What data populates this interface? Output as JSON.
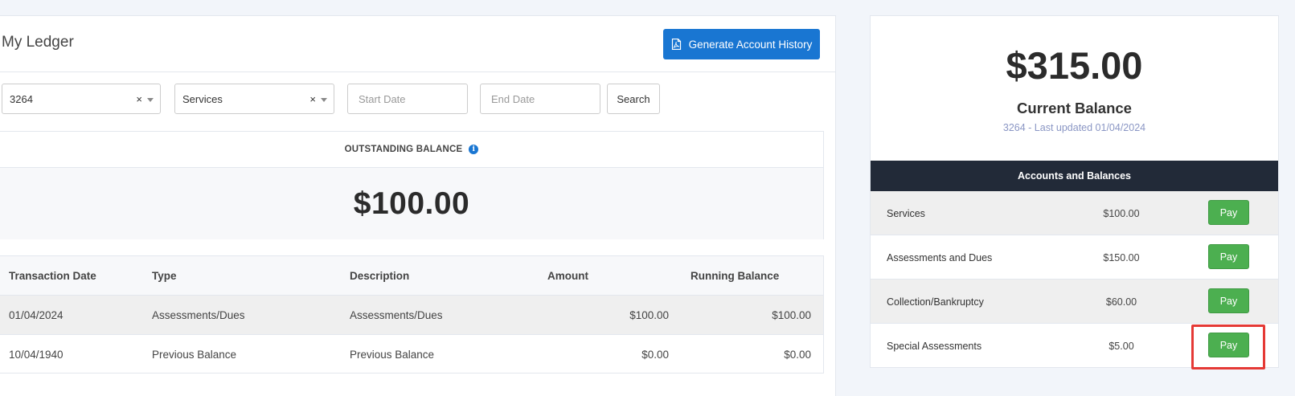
{
  "ledger": {
    "title": "My Ledger",
    "generate_button": "Generate Account History",
    "filters": {
      "account_value": "3264",
      "category_value": "Services",
      "clear_glyph": "×",
      "start_placeholder": "Start Date",
      "end_placeholder": "End Date",
      "search_label": "Search"
    },
    "outstanding": {
      "label": "OUTSTANDING BALANCE",
      "amount": "$100.00"
    },
    "table": {
      "headers": [
        "Transaction Date",
        "Type",
        "Description",
        "Amount",
        "Running Balance"
      ],
      "rows": [
        [
          "01/04/2024",
          "Assessments/Dues",
          "Assessments/Dues",
          "$100.00",
          "$100.00"
        ],
        [
          "10/04/1940",
          "Previous Balance",
          "Previous Balance",
          "$0.00",
          "$0.00"
        ]
      ]
    }
  },
  "balance_card": {
    "amount": "$315.00",
    "label": "Current Balance",
    "sub": "3264 - Last updated 01/04/2024",
    "accounts_header": "Accounts and Balances",
    "accounts": [
      {
        "name": "Services",
        "amount": "$100.00",
        "action": "Pay"
      },
      {
        "name": "Assessments and Dues",
        "amount": "$150.00",
        "action": "Pay"
      },
      {
        "name": "Collection/Bankruptcy",
        "amount": "$60.00",
        "action": "Pay"
      },
      {
        "name": "Special Assessments",
        "amount": "$5.00",
        "action": "Pay"
      }
    ]
  },
  "colors": {
    "primary": "#1976d2",
    "pay": "#4caf50",
    "header_dark": "#222a38",
    "highlight": "#e53935"
  }
}
